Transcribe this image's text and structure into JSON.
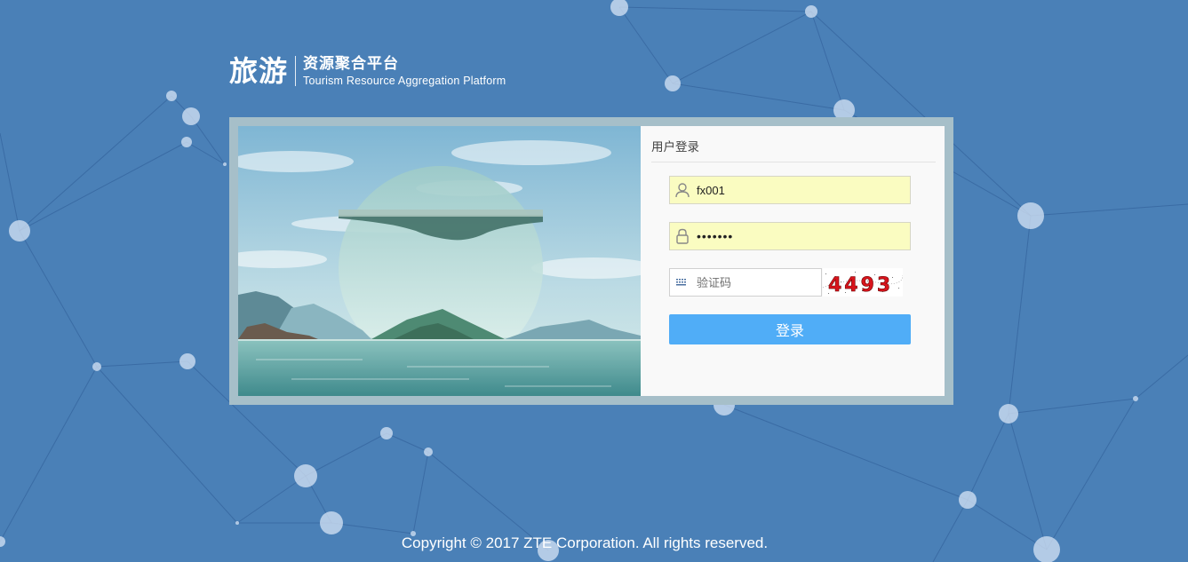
{
  "logo": {
    "main": "旅游",
    "cn": "资源聚合平台",
    "en": "Tourism Resource Aggregation Platform"
  },
  "login": {
    "title": "用户登录",
    "username_value": "fx001",
    "password_value": "•••••••",
    "captcha_placeholder": "验证码",
    "captcha_code": "4493",
    "submit_label": "登录"
  },
  "icons": {
    "user": "user-icon",
    "lock": "lock-icon",
    "captcha": "keyboard-icon"
  },
  "colors": {
    "background": "#4a80b7",
    "frame": "#a6bfc9",
    "input_fill": "#fafcc1",
    "button": "#50adf7",
    "captcha_digits": "#d8141c"
  },
  "footer": {
    "copyright": "Copyright © 2017 ZTE Corporation. All rights reserved."
  }
}
